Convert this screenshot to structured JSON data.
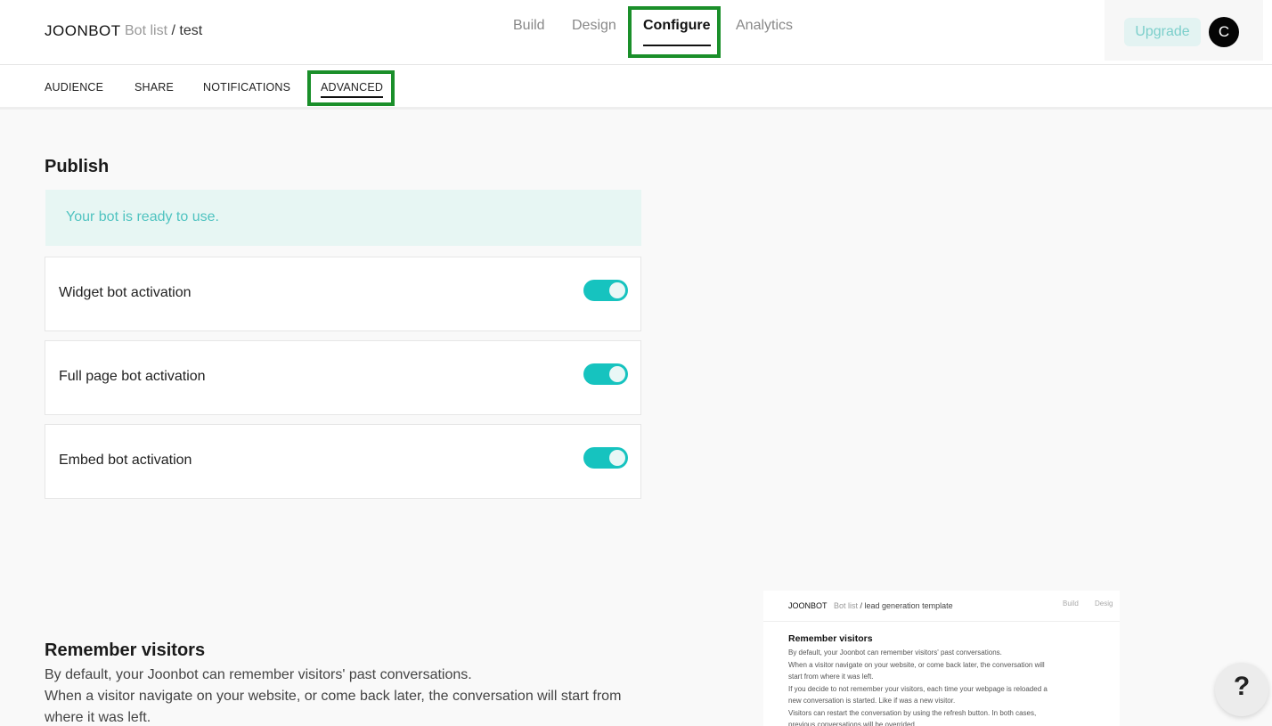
{
  "header": {
    "logo": "JOONBOT",
    "breadcrumb_parent": "Bot list",
    "breadcrumb_sep": "/",
    "breadcrumb_current": "test",
    "tabs": [
      {
        "label": "Build"
      },
      {
        "label": "Design"
      },
      {
        "label": "Configure",
        "active": true
      },
      {
        "label": "Analytics"
      }
    ],
    "upgrade_label": "Upgrade",
    "avatar_initial": "C"
  },
  "subnav": {
    "tabs": [
      {
        "label": "AUDIENCE"
      },
      {
        "label": "SHARE"
      },
      {
        "label": "NOTIFICATIONS"
      },
      {
        "label": "ADVANCED",
        "active": true
      }
    ]
  },
  "publish": {
    "title": "Publish",
    "status_message": "Your bot is ready to use.",
    "toggles": [
      {
        "label": "Widget bot activation",
        "enabled": true
      },
      {
        "label": "Full page bot activation",
        "enabled": true
      },
      {
        "label": "Embed bot activation",
        "enabled": true
      }
    ]
  },
  "remember": {
    "title": "Remember visitors",
    "line1": "By default, your Joonbot can remember visitors' past conversations.",
    "line2": "When a visitor navigate on your website, or come back later, the conversation will start from where it was left."
  },
  "preview": {
    "logo": "JOONBOT",
    "crumb_parent": "Bot list",
    "crumb_current": "/ lead generation template",
    "tab_build": "Build",
    "tab_design": "Desig",
    "title": "Remember visitors",
    "lines": [
      "By default, your Joonbot can remember visitors' past conversations.",
      "When a visitor navigate on your website, or come back later, the conversation will",
      "start from where it was left.",
      "If you decide to not remember your visitors, each time your webpage is reloaded a",
      "new conversation is started. Like if was a new visitor.",
      "Visitors can restart the conversation by using the refresh button. In both cases,",
      "previous conversations will be overrided."
    ]
  },
  "help": {
    "label": "?"
  },
  "colors": {
    "accent": "#16c3bf",
    "highlight": "#1a8f2a",
    "banner_bg": "#e7f6f3",
    "banner_text": "#4fc3c0"
  },
  "icons": {
    "help": "question-mark-icon"
  }
}
